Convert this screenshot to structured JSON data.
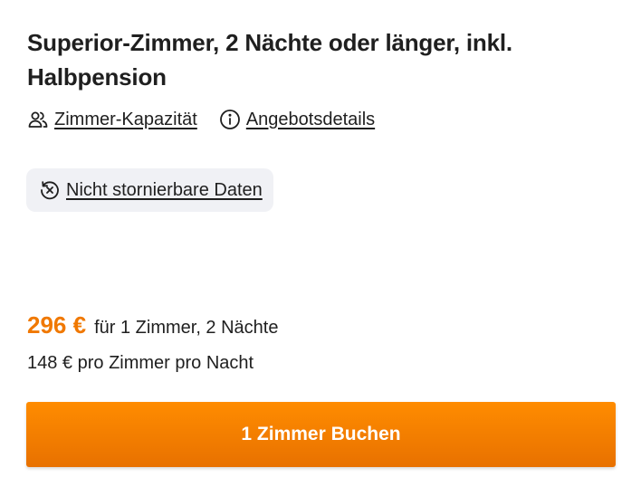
{
  "offer": {
    "title": "Superior-Zimmer, 2 Nächte oder länger, inkl. Halbpension",
    "links": {
      "capacity_label": "Zimmer-Kapazität",
      "capacity_icon": "people-icon",
      "details_label": "Angebotsdetails",
      "details_icon": "info-icon"
    },
    "cancellation": {
      "label": "Nicht stornierbare Daten",
      "icon": "no-cancel-icon"
    },
    "pricing": {
      "total_price": "296 €",
      "total_desc": "für 1 Zimmer, 2 Nächte",
      "per_night": "148 € pro Zimmer pro Nacht"
    },
    "book_button_label": "1 Zimmer Buchen"
  },
  "colors": {
    "accent": "#f07800",
    "button_top": "#ff8c00",
    "button_bottom": "#e87100",
    "chip_background": "#f0f1f5",
    "text": "#1f1f1f"
  }
}
